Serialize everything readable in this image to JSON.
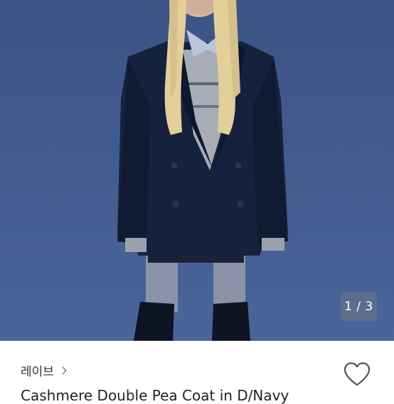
{
  "gallery": {
    "indicator": "1 / 3",
    "image_alt": "model wearing navy double-breasted coat"
  },
  "seller": {
    "name": "레이브"
  },
  "product": {
    "title": "Cashmere Double Pea Coat in D/Navy"
  },
  "colors": {
    "background": "#3e5a8c",
    "coat": "#14213a"
  },
  "icons": {
    "like": "heart-outline-icon",
    "seller_arrow": "chevron-right-icon"
  }
}
